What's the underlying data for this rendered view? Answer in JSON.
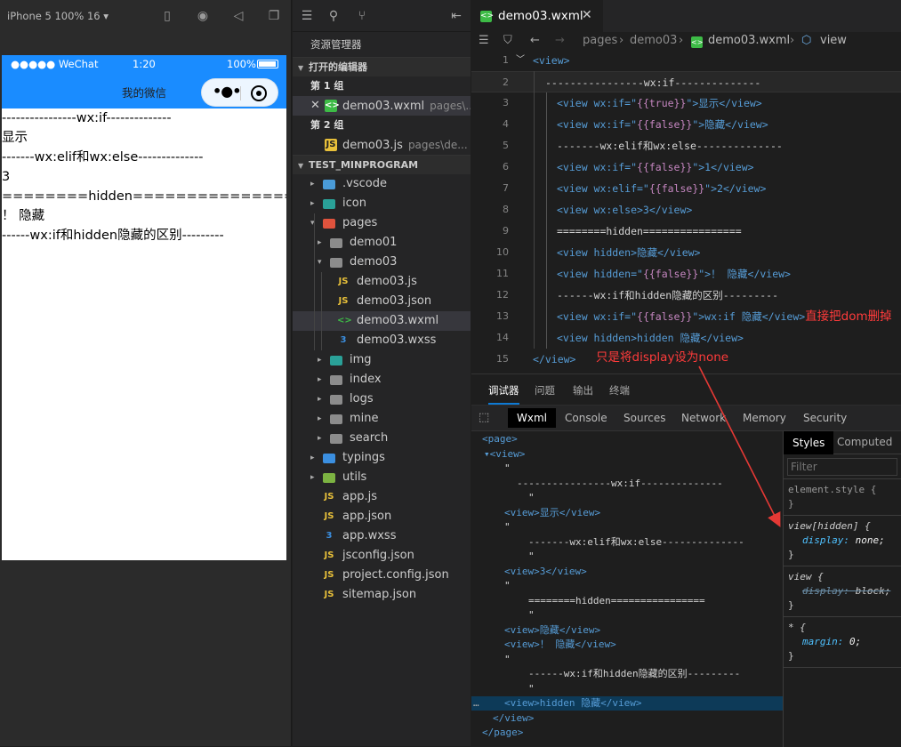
{
  "simulator": {
    "device_label": "iPhone 5 100% 16 ▾",
    "status": {
      "carrier": "●●●●● WeChat",
      "time": "1:20",
      "battery": "100%"
    },
    "nav_title": "我的微信",
    "content_lines": [
      "----------------wx:if--------------",
      "显示",
      "-------wx:elif和wx:else--------------",
      "3",
      "========hidden================",
      "！ 隐藏",
      "------wx:if和hidden隐藏的区别---------"
    ]
  },
  "explorer": {
    "title": "资源管理器",
    "open_editors_label": "打开的编辑器",
    "group1_label": "第 1 组",
    "group2_label": "第 2 组",
    "open_file1": {
      "name": "demo03.wxml",
      "desc": "pages\\..."
    },
    "open_file2": {
      "name": "demo03.js",
      "desc": "pages\\de..."
    },
    "project_label": "TEST_MINPROGRAM",
    "tree": [
      {
        "label": ".vscode",
        "icon": "folder-vscode-icon",
        "color": "#4a9bd8"
      },
      {
        "label": "icon",
        "icon": "folder-icon",
        "color": "#2aa198"
      },
      {
        "label": "pages",
        "icon": "folder-pages-icon",
        "color": "#e0533d"
      },
      {
        "label": "demo01",
        "icon": "folder-icon",
        "color": "#8c8c8c"
      },
      {
        "label": "demo03",
        "icon": "folder-open-icon",
        "color": "#8c8c8c"
      },
      {
        "label": "demo03.js",
        "icon": "js-file-icon",
        "color": "#e8c03a"
      },
      {
        "label": "demo03.json",
        "icon": "json-file-icon",
        "color": "#e8c03a"
      },
      {
        "label": "demo03.wxml",
        "icon": "wxml-file-icon",
        "color": "#3dbb46"
      },
      {
        "label": "demo03.wxss",
        "icon": "css-file-icon",
        "color": "#3b8fe0"
      },
      {
        "label": "img",
        "icon": "folder-img-icon",
        "color": "#2aa198"
      },
      {
        "label": "index",
        "icon": "folder-icon",
        "color": "#8c8c8c"
      },
      {
        "label": "logs",
        "icon": "folder-icon",
        "color": "#8c8c8c"
      },
      {
        "label": "mine",
        "icon": "folder-icon",
        "color": "#8c8c8c"
      },
      {
        "label": "search",
        "icon": "folder-icon",
        "color": "#8c8c8c"
      },
      {
        "label": "typings",
        "icon": "folder-ts-icon",
        "color": "#3b8fe0"
      },
      {
        "label": "utils",
        "icon": "folder-utils-icon",
        "color": "#7cb342"
      },
      {
        "label": "app.js",
        "icon": "js-file-icon",
        "color": "#e8c03a"
      },
      {
        "label": "app.json",
        "icon": "json-file-icon",
        "color": "#e8c03a"
      },
      {
        "label": "app.wxss",
        "icon": "css-file-icon",
        "color": "#3b8fe0"
      },
      {
        "label": "jsconfig.json",
        "icon": "json-file-icon",
        "color": "#e8c03a"
      },
      {
        "label": "project.config.json",
        "icon": "json-file-icon",
        "color": "#e8c03a"
      },
      {
        "label": "sitemap.json",
        "icon": "json-file-icon",
        "color": "#e8c03a"
      }
    ]
  },
  "editor": {
    "tab_name": "demo03.wxml",
    "breadcrumb": {
      "p1": "pages",
      "p2": "demo03",
      "p3": "demo03.wxml",
      "p4": "view"
    },
    "line_numbers": [
      "1",
      "2",
      "3",
      "4",
      "5",
      "6",
      "7",
      "8",
      "9",
      "10",
      "11",
      "12",
      "13",
      "14",
      "15"
    ],
    "code": {
      "l1": "<view>",
      "l2": "----------------wx:if--------------",
      "l3a": "<view wx:if=\"",
      "l3b": "{{true}}",
      "l3c": "\">显示</view>",
      "l4a": "<view wx:if=\"",
      "l4b": "{{false}}",
      "l4c": "\">隐藏</view>",
      "l5": "-------wx:elif和wx:else--------------",
      "l6a": "<view wx:if=\"",
      "l6b": "{{false}}",
      "l6c": "\">1</view>",
      "l7a": "<view wx:elif=\"",
      "l7b": "{{false}}",
      "l7c": "\">2</view>",
      "l8": "<view wx:else>3</view>",
      "l9": "========hidden================",
      "l10": "<view hidden>隐藏</view>",
      "l11a": "<view hidden=\"",
      "l11b": "{{false}}",
      "l11c": "\">！ 隐藏</view>",
      "l12": "------wx:if和hidden隐藏的区别---------",
      "l13a": "<view wx:if=\"",
      "l13b": "{{false}}",
      "l13c": "\">wx:if 隐藏</view>",
      "l14": "<view hidden>hidden 隐藏</view>",
      "l15": "</view>"
    },
    "annotation1": "直接把dom删掉",
    "annotation2": "只是将display设为none"
  },
  "debugger": {
    "tabs": [
      "调试器",
      "问题",
      "输出",
      "终端"
    ],
    "devtools_tabs": [
      "Wxml",
      "Console",
      "Sources",
      "Network",
      "Memory",
      "Security"
    ],
    "tree": [
      "<page>",
      "▾<view>",
      "\"",
      "----------------wx:if--------------",
      "\"",
      "<view>显示</view>",
      "\"",
      "-------wx:elif和wx:else--------------",
      "\"",
      "<view>3</view>",
      "\"",
      "========hidden================",
      "\"",
      "<view>隐藏</view>",
      "<view>！ 隐藏</view>",
      "\"",
      "------wx:if和hidden隐藏的区别---------",
      "\"",
      "<view>hidden 隐藏</view>",
      "</view>",
      "</page>"
    ],
    "styles_tab": "Styles",
    "computed_tab": "Computed",
    "filter_placeholder": "Filter",
    "rules": {
      "r1": "element.style {",
      "r1e": "}",
      "r2": "view[hidden] {",
      "r2p": "display",
      "r2v": "none;",
      "r2e": "}",
      "r3": "view {",
      "r3p": "display",
      "r3v": "block;",
      "r3e": "}",
      "r4": "* {",
      "r4p": "margin",
      "r4v": "0;",
      "r4e": "}"
    }
  }
}
